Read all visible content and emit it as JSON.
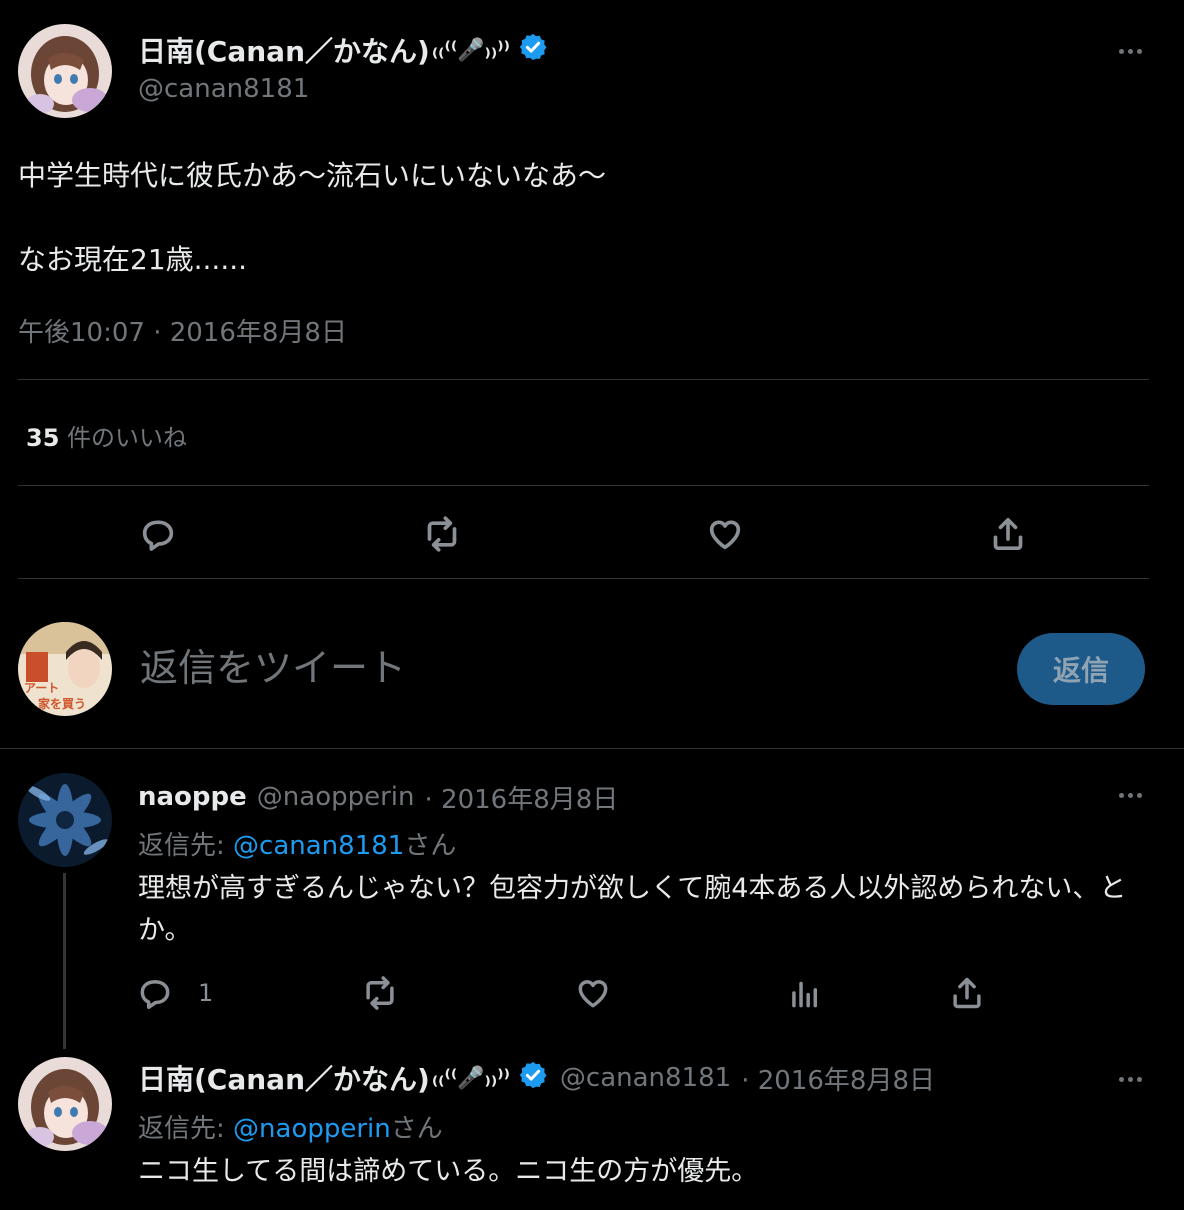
{
  "tweet": {
    "display_name": "日南(Canan／かなん)",
    "name_emoji": "₍₍⁽⁽🎤₎₎⁾⁾",
    "handle": "@canan8181",
    "text_line1": "中学生時代に彼氏かあ〜流石いにいないなあ〜",
    "text_line2": "なお現在21歳......",
    "timestamp": "午後10:07 · 2016年8月8日",
    "likes_count": "35",
    "likes_label": "件のいいね"
  },
  "reply_box": {
    "placeholder": "返信をツイート",
    "button_label": "返信"
  },
  "replies": [
    {
      "display_name": "naoppe",
      "handle": "@naopperin",
      "date": "· 2016年8月8日",
      "reply_to_prefix": "返信先: ",
      "reply_to_handle": "@canan8181",
      "reply_to_suffix": "さん",
      "text": "理想が高すぎるんじゃない？包容力が欲しくて腕4本ある人以外認められない、とか。",
      "reply_count": "1"
    },
    {
      "display_name": "日南(Canan／かなん)",
      "name_emoji": "₍₍⁽⁽🎤₎₎⁾⁾",
      "handle": "@canan8181",
      "date": "· 2016年8月8日",
      "reply_to_prefix": "返信先: ",
      "reply_to_handle": "@naopperin",
      "reply_to_suffix": "さん",
      "text": "ニコ生してる間は諦めている。ニコ生の方が優先。"
    }
  ],
  "colors": {
    "background": "#000000",
    "text": "#e7e9ea",
    "muted": "#71767b",
    "link": "#1d9bf0",
    "verified": "#1d9bf0",
    "reply_button": "#1d5a8a"
  }
}
